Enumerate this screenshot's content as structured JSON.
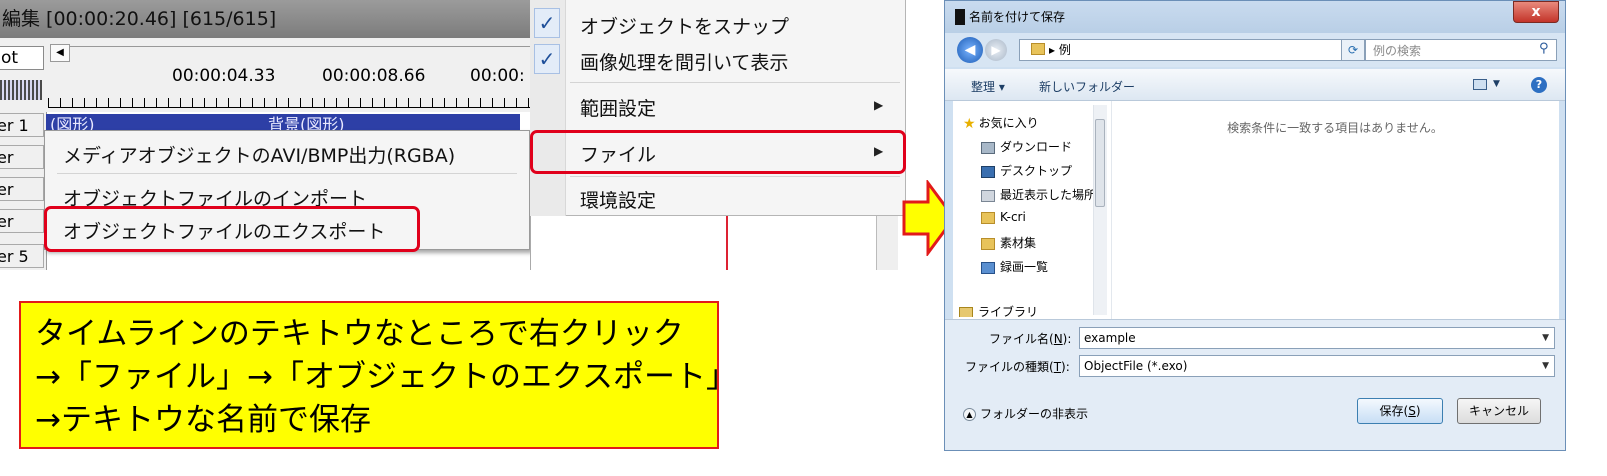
{
  "timeline": {
    "title": "編集 [00:00:20.46] [615/615]",
    "zoom_value": "ot",
    "time_marks": [
      "00:00:04.33",
      "00:00:08.66",
      "00:00:"
    ],
    "layers": [
      "er 1",
      "er",
      "er",
      "er",
      "er 5"
    ],
    "object_label_1": "(図形)",
    "object_label_2": "背景(図形)"
  },
  "context_menu": {
    "items": [
      "メディアオブジェクトのAVI/BMP出力(RGBA)",
      "オブジェクトファイルのインポート",
      "オブジェクトファイルのエクスポート"
    ],
    "highlighted_index": 2
  },
  "top_menu": {
    "items": [
      {
        "label": "オブジェクトをスナップ",
        "checked": true
      },
      {
        "label": "画像処理を間引いて表示",
        "checked": true
      },
      {
        "label": "範囲設定",
        "submenu": true
      },
      {
        "label": "ファイル",
        "submenu": true,
        "highlighted": true
      },
      {
        "label": "環境設定"
      }
    ],
    "check_glyph": "✓",
    "arrow_glyph": "▶"
  },
  "instruction": {
    "lines": [
      "タイムラインのテキトウなところで右クリック",
      "→「ファイル」→「オブジェクトのエクスポート」",
      "→テキトウな名前で保存"
    ],
    "background_color": "#ffff00",
    "border_color": "#e21a1a"
  },
  "arrow": {
    "fill_color": "#ffff00",
    "stroke_color": "#e21a1a"
  },
  "save_dialog": {
    "title": "名前を付けて保存",
    "close_glyph": "x",
    "address_path": "▸ 例",
    "search_placeholder": "例の検索",
    "toolbar": {
      "organize": "整理 ▾",
      "new_folder": "新しいフォルダー",
      "help": "?"
    },
    "nav_items": [
      {
        "label": "お気に入り",
        "icon": "star-icon"
      },
      {
        "label": "ダウンロード",
        "icon": "download-folder-icon"
      },
      {
        "label": "デスクトップ",
        "icon": "desktop-icon"
      },
      {
        "label": "最近表示した場所",
        "icon": "recent-places-icon"
      },
      {
        "label": "K-cri",
        "icon": "folder-icon"
      },
      {
        "label": "素材集",
        "icon": "folder-icon"
      },
      {
        "label": "録画一覧",
        "icon": "video-folder-icon"
      },
      {
        "label": "ライブラリ",
        "icon": "library-icon"
      }
    ],
    "empty_message": "検索条件に一致する項目はありません。",
    "filename_label": "ファイル名(",
    "filename_key": "N",
    "filename_label_end": "):",
    "filename_value": "example",
    "filetype_label": "ファイルの種類(",
    "filetype_key": "T",
    "filetype_label_end": "):",
    "filetype_value": "ObjectFile (*.exo)",
    "hide_folders": "フォルダーの非表示",
    "save_label": "保存(",
    "save_key": "S",
    "save_label_end": ")",
    "cancel_label": "キャンセル"
  }
}
